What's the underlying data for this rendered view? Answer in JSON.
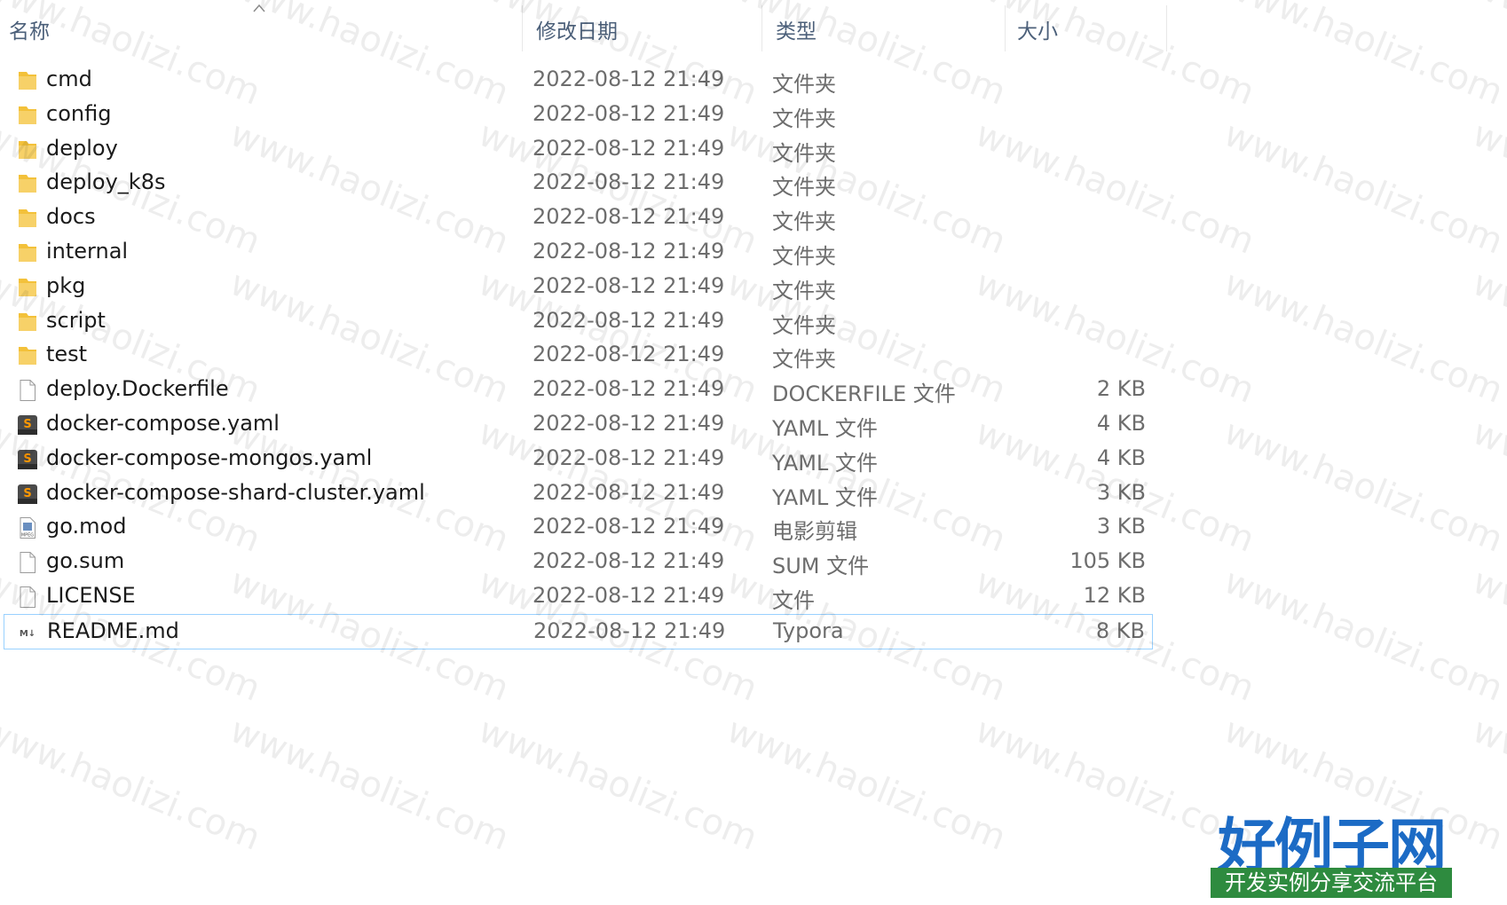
{
  "columns": {
    "name": "名称",
    "date": "修改日期",
    "type": "类型",
    "size": "大小"
  },
  "files": [
    {
      "name": "cmd",
      "date": "2022-08-12 21:49",
      "type": "文件夹",
      "size": "",
      "icon": "folder-icon"
    },
    {
      "name": "config",
      "date": "2022-08-12 21:49",
      "type": "文件夹",
      "size": "",
      "icon": "folder-icon"
    },
    {
      "name": "deploy",
      "date": "2022-08-12 21:49",
      "type": "文件夹",
      "size": "",
      "icon": "folder-icon"
    },
    {
      "name": "deploy_k8s",
      "date": "2022-08-12 21:49",
      "type": "文件夹",
      "size": "",
      "icon": "folder-icon"
    },
    {
      "name": "docs",
      "date": "2022-08-12 21:49",
      "type": "文件夹",
      "size": "",
      "icon": "folder-icon"
    },
    {
      "name": "internal",
      "date": "2022-08-12 21:49",
      "type": "文件夹",
      "size": "",
      "icon": "folder-icon"
    },
    {
      "name": "pkg",
      "date": "2022-08-12 21:49",
      "type": "文件夹",
      "size": "",
      "icon": "folder-icon"
    },
    {
      "name": "script",
      "date": "2022-08-12 21:49",
      "type": "文件夹",
      "size": "",
      "icon": "folder-icon"
    },
    {
      "name": "test",
      "date": "2022-08-12 21:49",
      "type": "文件夹",
      "size": "",
      "icon": "folder-icon"
    },
    {
      "name": "deploy.Dockerfile",
      "date": "2022-08-12 21:49",
      "type": "DOCKERFILE 文件",
      "size": "2 KB",
      "icon": "blank-file-icon"
    },
    {
      "name": "docker-compose.yaml",
      "date": "2022-08-12 21:49",
      "type": "YAML 文件",
      "size": "4 KB",
      "icon": "sublime-file-icon"
    },
    {
      "name": "docker-compose-mongos.yaml",
      "date": "2022-08-12 21:49",
      "type": "YAML 文件",
      "size": "4 KB",
      "icon": "sublime-file-icon"
    },
    {
      "name": "docker-compose-shard-cluster.yaml",
      "date": "2022-08-12 21:49",
      "type": "YAML 文件",
      "size": "3 KB",
      "icon": "sublime-file-icon"
    },
    {
      "name": "go.mod",
      "date": "2022-08-12 21:49",
      "type": "电影剪辑",
      "size": "3 KB",
      "icon": "mpeg-file-icon"
    },
    {
      "name": "go.sum",
      "date": "2022-08-12 21:49",
      "type": "SUM 文件",
      "size": "105 KB",
      "icon": "blank-file-icon"
    },
    {
      "name": "LICENSE",
      "date": "2022-08-12 21:49",
      "type": "文件",
      "size": "12 KB",
      "icon": "blank-file-icon"
    },
    {
      "name": "README.md",
      "date": "2022-08-12 21:49",
      "type": "Typora",
      "size": "8 KB",
      "icon": "markdown-file-icon",
      "selected": true
    }
  ],
  "watermark": {
    "text": "www.haolizi.com"
  },
  "logo": {
    "title": "好例子网",
    "subtitle": "开发实例分享交流平台"
  },
  "colors": {
    "folder": "#f3c13a",
    "header_text": "#4c607a",
    "selection_border": "#99d1ff",
    "logo_blue": "#1c6bc5",
    "logo_green": "#2e8b3f"
  }
}
